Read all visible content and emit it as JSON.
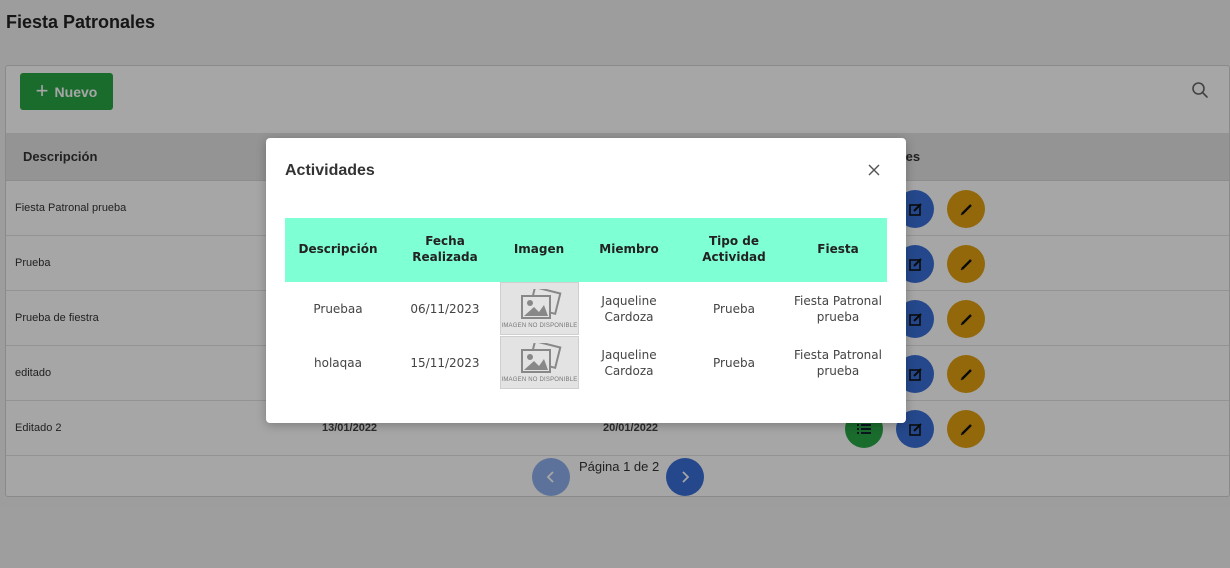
{
  "page": {
    "title": "Fiesta Patronales"
  },
  "toolbar": {
    "new_label": "Nuevo",
    "search_icon": "search-icon"
  },
  "table": {
    "headers": [
      "Descripción",
      "les"
    ],
    "rows": [
      {
        "descripcion": "Fiesta Patronal prueba",
        "fecha_inicio": "",
        "fecha_fin": ""
      },
      {
        "descripcion": "Prueba",
        "fecha_inicio": "",
        "fecha_fin": ""
      },
      {
        "descripcion": "Prueba de fiestra",
        "fecha_inicio": "",
        "fecha_fin": ""
      },
      {
        "descripcion": "editado",
        "fecha_inicio": "",
        "fecha_fin": ""
      },
      {
        "descripcion": "Editado 2",
        "fecha_inicio": "13/01/2022",
        "fecha_fin": "20/01/2022"
      }
    ]
  },
  "pagination": {
    "text": "Página 1 de 2"
  },
  "modal": {
    "title": "Actividades",
    "headers": [
      "Descripción",
      "Fecha Realizada",
      "Imagen",
      "Miembro",
      "Tipo de Actividad",
      "Fiesta"
    ],
    "rows": [
      {
        "descripcion": "Pruebaa",
        "fecha": "06/11/2023",
        "imagen": "IMAGEN NO DISPONIBLE",
        "miembro": "Jaqueline Cardoza",
        "tipo": "Prueba",
        "fiesta": "Fiesta Patronal prueba"
      },
      {
        "descripcion": "holaqaa",
        "fecha": "15/11/2023",
        "imagen": "IMAGEN NO DISPONIBLE",
        "miembro": "Jaqueline Cardoza",
        "tipo": "Prueba",
        "fiesta": "Fiesta Patronal prueba"
      }
    ]
  },
  "colors": {
    "primary": "#3a6fd8",
    "success": "#28a745",
    "warning": "#e0a012",
    "modal_header": "#7fffd4"
  }
}
